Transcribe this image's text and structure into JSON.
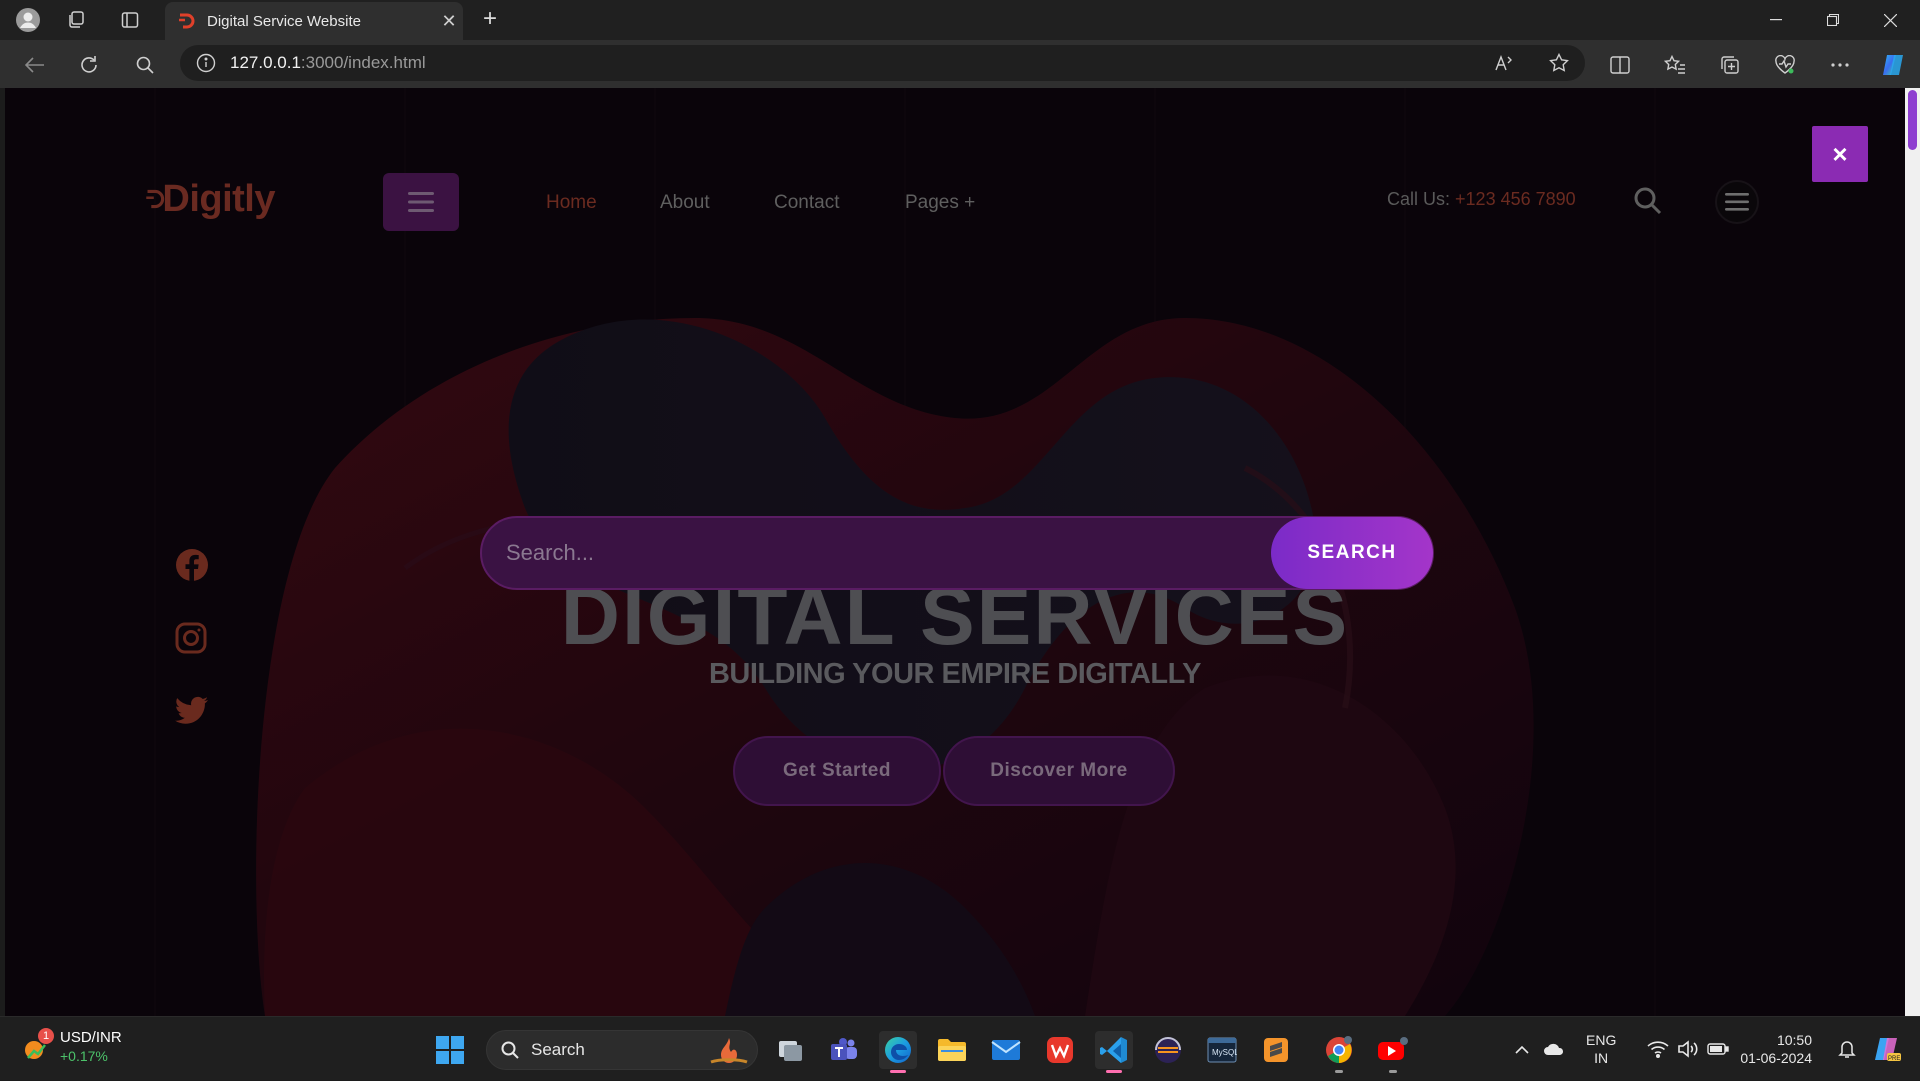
{
  "browser": {
    "tab_title": "Digital Service Website",
    "url_host": "127.0.0.1",
    "url_rest": ":3000/index.html"
  },
  "site": {
    "logo_text": "Digitly",
    "nav": {
      "home": "Home",
      "about": "About",
      "contact": "Contact",
      "pages": "Pages +"
    },
    "call_us_label": "Call Us:",
    "call_us_number": "+123 456 7890",
    "hero_title": "DIGITAL SERVICES",
    "hero_subtitle": "BUILDING YOUR EMPIRE DIGITALLY",
    "btn_get_started": "Get Started",
    "btn_discover": "Discover More",
    "search": {
      "placeholder": "Search...",
      "button": "SEARCH",
      "close": "×"
    },
    "social": [
      "facebook-icon",
      "instagram-icon",
      "twitter-icon"
    ],
    "colors": {
      "accent_purple": "#8b2bb3",
      "brand_orange": "#e0402a",
      "overlay": "rgba(8,4,10,0.78)"
    }
  },
  "taskbar": {
    "widget_pair": "USD/INR",
    "widget_change": "+0.17%",
    "widget_badge": "1",
    "search_label": "Search",
    "lang_top": "ENG",
    "lang_bottom": "IN",
    "time": "10:50",
    "date": "01-06-2024"
  }
}
